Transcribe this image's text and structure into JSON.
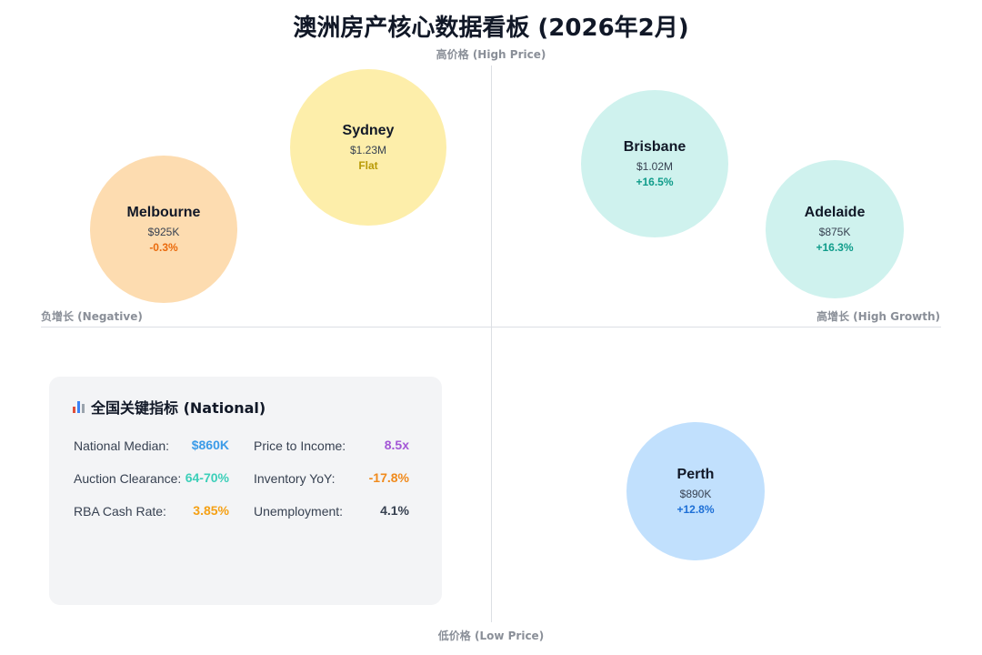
{
  "title": "澳洲房产核心数据看板 (2026年2月)",
  "axes": {
    "top": "高价格 (High Price)",
    "bottom": "低价格 (Low Price)",
    "left": "负增长 (Negative)",
    "right": "高增长 (High Growth)"
  },
  "chart_data": {
    "type": "scatter",
    "title": "澳洲房产核心数据看板 (2026年2月)",
    "x_axis": {
      "negative_label": "负增长 (Negative)",
      "positive_label": "高增长 (High Growth)"
    },
    "y_axis": {
      "high_label": "高价格 (High Price)",
      "low_label": "低价格 (Low Price)"
    },
    "points": [
      {
        "city": "Sydney",
        "price_label": "$1.23M",
        "price_k": 1230,
        "growth_label": "Flat",
        "growth_pct": 0.0,
        "color": "#fdeeaa",
        "growth_color": "#b99a06"
      },
      {
        "city": "Melbourne",
        "price_label": "$925K",
        "price_k": 925,
        "growth_label": "-0.3%",
        "growth_pct": -0.3,
        "color": "#fddcb0",
        "growth_color": "#ea6a0c"
      },
      {
        "city": "Brisbane",
        "price_label": "$1.02M",
        "price_k": 1020,
        "growth_label": "+16.5%",
        "growth_pct": 16.5,
        "color": "#cff2ee",
        "growth_color": "#0f9c8a"
      },
      {
        "city": "Adelaide",
        "price_label": "$875K",
        "price_k": 875,
        "growth_label": "+16.3%",
        "growth_pct": 16.3,
        "color": "#cff2ee",
        "growth_color": "#0f9c8a"
      },
      {
        "city": "Perth",
        "price_label": "$890K",
        "price_k": 890,
        "growth_label": "+12.8%",
        "growth_pct": 12.8,
        "color": "#c1e0fd",
        "growth_color": "#1d6fd6"
      }
    ]
  },
  "national": {
    "icon": "bar-chart-icon",
    "title": "全国关键指标 (National)",
    "metrics": [
      {
        "label": "National Median:",
        "value": "$860K",
        "color": "#3b9be8"
      },
      {
        "label": "Price to Income:",
        "value": "8.5x",
        "color": "#a356d6"
      },
      {
        "label": "Auction Clearance:",
        "value": "64-70%",
        "color": "#3ccfb9"
      },
      {
        "label": "Inventory YoY:",
        "value": "-17.8%",
        "color": "#f08a1c"
      },
      {
        "label": "RBA Cash Rate:",
        "value": "3.85%",
        "color": "#f5a014"
      },
      {
        "label": "Unemployment:",
        "value": "4.1%",
        "color": "#374151"
      }
    ]
  }
}
